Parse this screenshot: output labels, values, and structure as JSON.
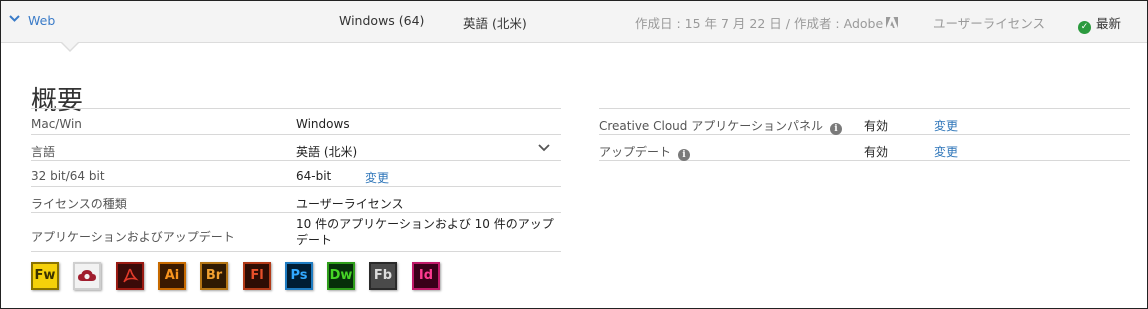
{
  "header": {
    "web_label": "Web",
    "os": "Windows (64)",
    "language": "英語 (北米)",
    "created": "作成日 : 15 年 7 月 22 日 / 作成者 : Adobe",
    "license": "ユーザーライセンス",
    "status": "最新"
  },
  "title": "概要",
  "properties": [
    {
      "label": "Mac/Win",
      "value": "Windows"
    },
    {
      "label": "言語",
      "value": "英語 (北米)"
    },
    {
      "label": "32 bit/64 bit",
      "value": "64-bit",
      "action": "変更"
    },
    {
      "label": "ライセンスの種類",
      "value": "ユーザーライセンス"
    },
    {
      "label": "アプリケーションおよびアップデート",
      "value": "10 件のアプリケーションおよび 10 件のアップデート"
    }
  ],
  "settings": [
    {
      "label": "Creative Cloud アプリケーションパネル",
      "value": "有効",
      "action": "変更"
    },
    {
      "label": "アップデート",
      "value": "有効",
      "action": "変更"
    }
  ],
  "apps": [
    {
      "code": "Fw",
      "name": "fireworks-icon",
      "fg": "#3b3300",
      "bg": "#f5d10a",
      "border": "#8a7300"
    },
    {
      "code": "",
      "name": "creative-cloud-icon",
      "fg": "#a01e2e",
      "bg": "#f2f2f2",
      "border": "#cfcfcf"
    },
    {
      "code": "",
      "name": "acrobat-icon",
      "fg": "#e23a2a",
      "bg": "#3a0a08",
      "border": "#9a1a12"
    },
    {
      "code": "Ai",
      "name": "illustrator-icon",
      "fg": "#f7941e",
      "bg": "#3a1a00",
      "border": "#c76a00"
    },
    {
      "code": "Br",
      "name": "bridge-icon",
      "fg": "#f0a030",
      "bg": "#2e1a02",
      "border": "#b37514"
    },
    {
      "code": "Fl",
      "name": "flash-icon",
      "fg": "#e8502a",
      "bg": "#2e0d04",
      "border": "#b23a18"
    },
    {
      "code": "Ps",
      "name": "photoshop-icon",
      "fg": "#31a8ff",
      "bg": "#001d34",
      "border": "#1f7cc2"
    },
    {
      "code": "Dw",
      "name": "dreamweaver-icon",
      "fg": "#46d426",
      "bg": "#07300a",
      "border": "#2e9e1a"
    },
    {
      "code": "Fb",
      "name": "flash-builder-icon",
      "fg": "#dcdcdc",
      "bg": "#4a4a4a",
      "border": "#2a2a2a"
    },
    {
      "code": "Id",
      "name": "indesign-icon",
      "fg": "#ff3a91",
      "bg": "#3a0019",
      "border": "#c01a68"
    }
  ]
}
